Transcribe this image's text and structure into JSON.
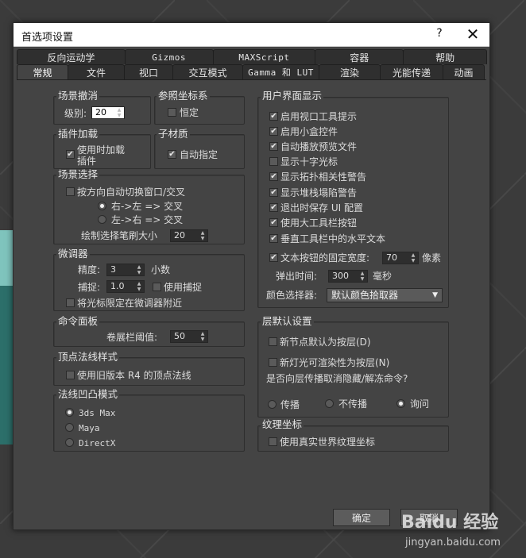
{
  "dialog": {
    "title": "首选项设置",
    "help": "?",
    "close": "✕"
  },
  "tabs_row1": [
    "反向运动学",
    "Gizmos",
    "MAXScript",
    "容器",
    "帮助"
  ],
  "tabs_row2": [
    "常规",
    "文件",
    "视口",
    "交互模式",
    "Gamma 和 LUT",
    "渲染",
    "光能传递",
    "动画"
  ],
  "scene_undo": {
    "title": "场景撤消",
    "levels_label": "级别:",
    "levels_value": "20"
  },
  "ref_coord": {
    "title": "参照坐标系",
    "constant_label": "恒定",
    "constant_checked": false
  },
  "plugin_load": {
    "title": "插件加载",
    "load_on_use_line1": "使用时加载",
    "load_on_use_line2": "插件",
    "load_on_use_checked": true
  },
  "sub_material": {
    "title": "子材质",
    "auto_assign_label": "自动指定",
    "auto_assign_checked": true
  },
  "scene_select": {
    "title": "场景选择",
    "auto_window_label": "按方向自动切换窗口/交叉",
    "auto_window_checked": false,
    "r2l_label": "右->左 => 交叉",
    "r2l_selected": true,
    "l2r_label": "左->右 => 交叉",
    "l2r_selected": false,
    "brush_size_label": "绘制选择笔刷大小",
    "brush_size_value": "20"
  },
  "spinners": {
    "title": "微调器",
    "precision_label": "精度:",
    "precision_value": "3",
    "decimals_label": "小数",
    "snap_label": "捕捉:",
    "snap_value": "1.0",
    "use_snap_label": "使用捕捉",
    "use_snap_checked": false,
    "wrap_cursor_label": "将光标限定在微调器附近",
    "wrap_cursor_checked": false
  },
  "command_panel": {
    "title": "命令面板",
    "rollout_label": "卷展栏阈值:",
    "rollout_value": "50"
  },
  "vertex_normal": {
    "title": "顶点法线样式",
    "legacy_label": "使用旧版本 R4 的顶点法线",
    "legacy_checked": false
  },
  "bump_mode": {
    "title": "法线凹凸模式",
    "options": [
      {
        "label": "3ds Max",
        "selected": true
      },
      {
        "label": "Maya",
        "selected": false
      },
      {
        "label": "DirectX",
        "selected": false
      }
    ]
  },
  "ui_display": {
    "title": "用户界面显示",
    "checkboxes": [
      {
        "label": "启用视口工具提示",
        "checked": true
      },
      {
        "label": "启用小盒控件",
        "checked": true
      },
      {
        "label": "自动播放预览文件",
        "checked": true
      },
      {
        "label": "显示十字光标",
        "checked": false
      },
      {
        "label": "显示拓扑相关性警告",
        "checked": true
      },
      {
        "label": "显示堆栈塌陷警告",
        "checked": true
      },
      {
        "label": "退出时保存 UI 配置",
        "checked": true
      },
      {
        "label": "使用大工具栏按钮",
        "checked": true
      },
      {
        "label": "垂直工具栏中的水平文本",
        "checked": true
      }
    ],
    "fixed_width_label": "文本按钮的固定宽度:",
    "fixed_width_checked": true,
    "fixed_width_value": "70",
    "fixed_width_unit": "像素",
    "flyout_label": "弹出时间:",
    "flyout_value": "300",
    "flyout_unit": "毫秒",
    "color_picker_label": "颜色选择器:",
    "color_picker_value": "默认颜色拾取器"
  },
  "layer_defaults": {
    "title": "层默认设置",
    "new_nodes_label": "新节点默认为按层(D)",
    "new_nodes_checked": false,
    "new_lights_label": "新灯光可渲染性为按层(N)",
    "new_lights_checked": false,
    "propagate_question": "是否向层传播取消隐藏/解冻命令?",
    "propagate_label": "传播",
    "propagate_selected": false,
    "no_propagate_label": "不传播",
    "no_propagate_selected": false,
    "ask_label": "询问",
    "ask_selected": true
  },
  "texture_coords": {
    "title": "纹理坐标",
    "real_world_label": "使用真实世界纹理坐标",
    "real_world_checked": false
  },
  "buttons": {
    "ok": "确定",
    "cancel": "取消"
  },
  "watermark": {
    "logo": "Baidu 经验",
    "url": "jingyan.baidu.com"
  }
}
